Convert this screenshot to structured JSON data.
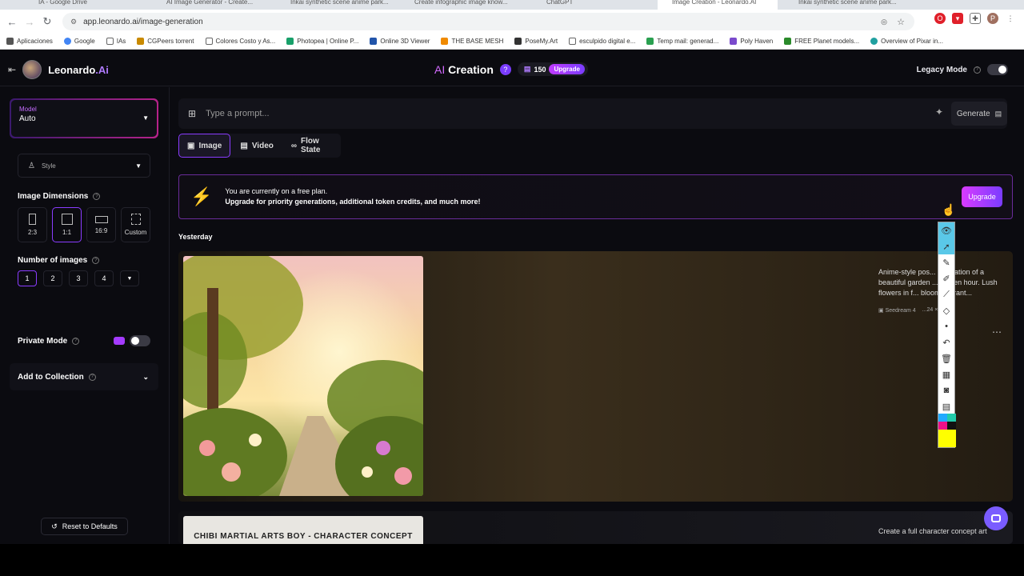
{
  "browser": {
    "tabs": [
      {
        "label": "IA - Google Drive"
      },
      {
        "label": "AI Image Generator - Create..."
      },
      {
        "label": "Inkai synthetic scene anime park..."
      },
      {
        "label": "Create infographic image know..."
      },
      {
        "label": "ChatGPT"
      },
      {
        "label": "Image Creation - Leonardo.AI"
      },
      {
        "label": "Inkai synthetic scene anime park..."
      }
    ],
    "url": "app.leonardo.ai/image-generation",
    "bookmarks": [
      "Aplicaciones",
      "Google",
      "IAs",
      "CGPeers torrent",
      "Colores Costo y As...",
      "Photopea | Online P...",
      "Online 3D Viewer",
      "THE BASE MESH",
      "PoseMy.Art",
      "esculpido digital e...",
      "Temp mail: generad...",
      "Poly Haven",
      "FREE Planet models...",
      "Overview of Pixar in..."
    ]
  },
  "header": {
    "brand": "Leonardo",
    "brand_suffix": ".Ai",
    "title_ai": "AI",
    "title": "Creation",
    "tokens": "150",
    "upgrade": "Upgrade",
    "legacy_mode": "Legacy Mode"
  },
  "sidebar": {
    "model_label": "Model",
    "model_value": "Auto",
    "style_label": "Style",
    "image_dimensions": "Image Dimensions",
    "dims": [
      {
        "label": "2:3"
      },
      {
        "label": "1:1"
      },
      {
        "label": "16:9"
      },
      {
        "label": "Custom"
      }
    ],
    "number_of_images": "Number of images",
    "counts": [
      "1",
      "2",
      "3",
      "4"
    ],
    "private_mode": "Private Mode",
    "add_to_collection": "Add to Collection",
    "reset": "Reset to Defaults"
  },
  "main": {
    "prompt_placeholder": "Type a prompt...",
    "generate": "Generate",
    "modes": [
      "Image",
      "Video",
      "Flow State"
    ],
    "banner_line1": "You are currently on a free plan.",
    "banner_line2": "Upgrade for priority generations, additional token credits, and much more!",
    "banner_button": "Upgrade",
    "day_label": "Yesterday",
    "card1_desc": "Anime-style pos... illustration of a beautiful garden ... golden hour. Lush flowers in f... bloom, vibrant...",
    "card1_model": "Seedream 4",
    "card1_size": "...24 × 1024",
    "card2_title": "CHIBI MARTIAL ARTS BOY - CHARACTER CONCEPT",
    "card2_desc": "Create a full character concept art"
  },
  "colors": {
    "accent": "#8a3cff",
    "upgrade_gradient_start": "#d93bff",
    "bolt": "#f6c000"
  }
}
